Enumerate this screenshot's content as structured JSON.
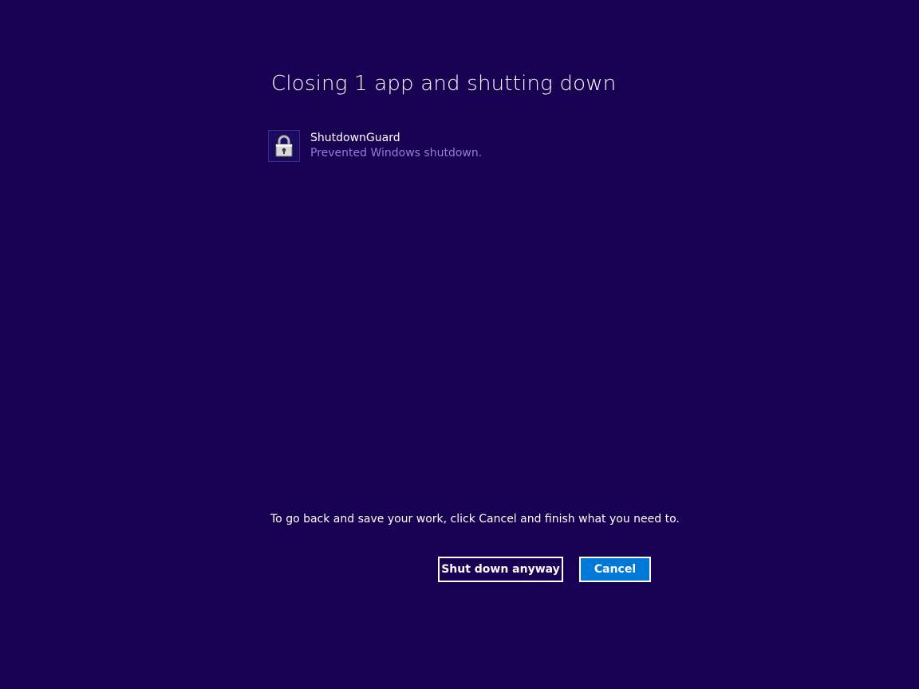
{
  "dialog": {
    "title": "Closing 1 app and shutting down",
    "hint": "To go back and save your work, click Cancel and finish what you need to."
  },
  "apps": [
    {
      "name": "ShutdownGuard",
      "status": "Prevented Windows shutdown.",
      "icon": "padlock-icon"
    }
  ],
  "buttons": {
    "shutdown_label": "Shut down anyway",
    "cancel_label": "Cancel"
  },
  "colors": {
    "background": "#180052",
    "status_text": "#8f7fd6",
    "cancel_accent": "#0078d7"
  }
}
